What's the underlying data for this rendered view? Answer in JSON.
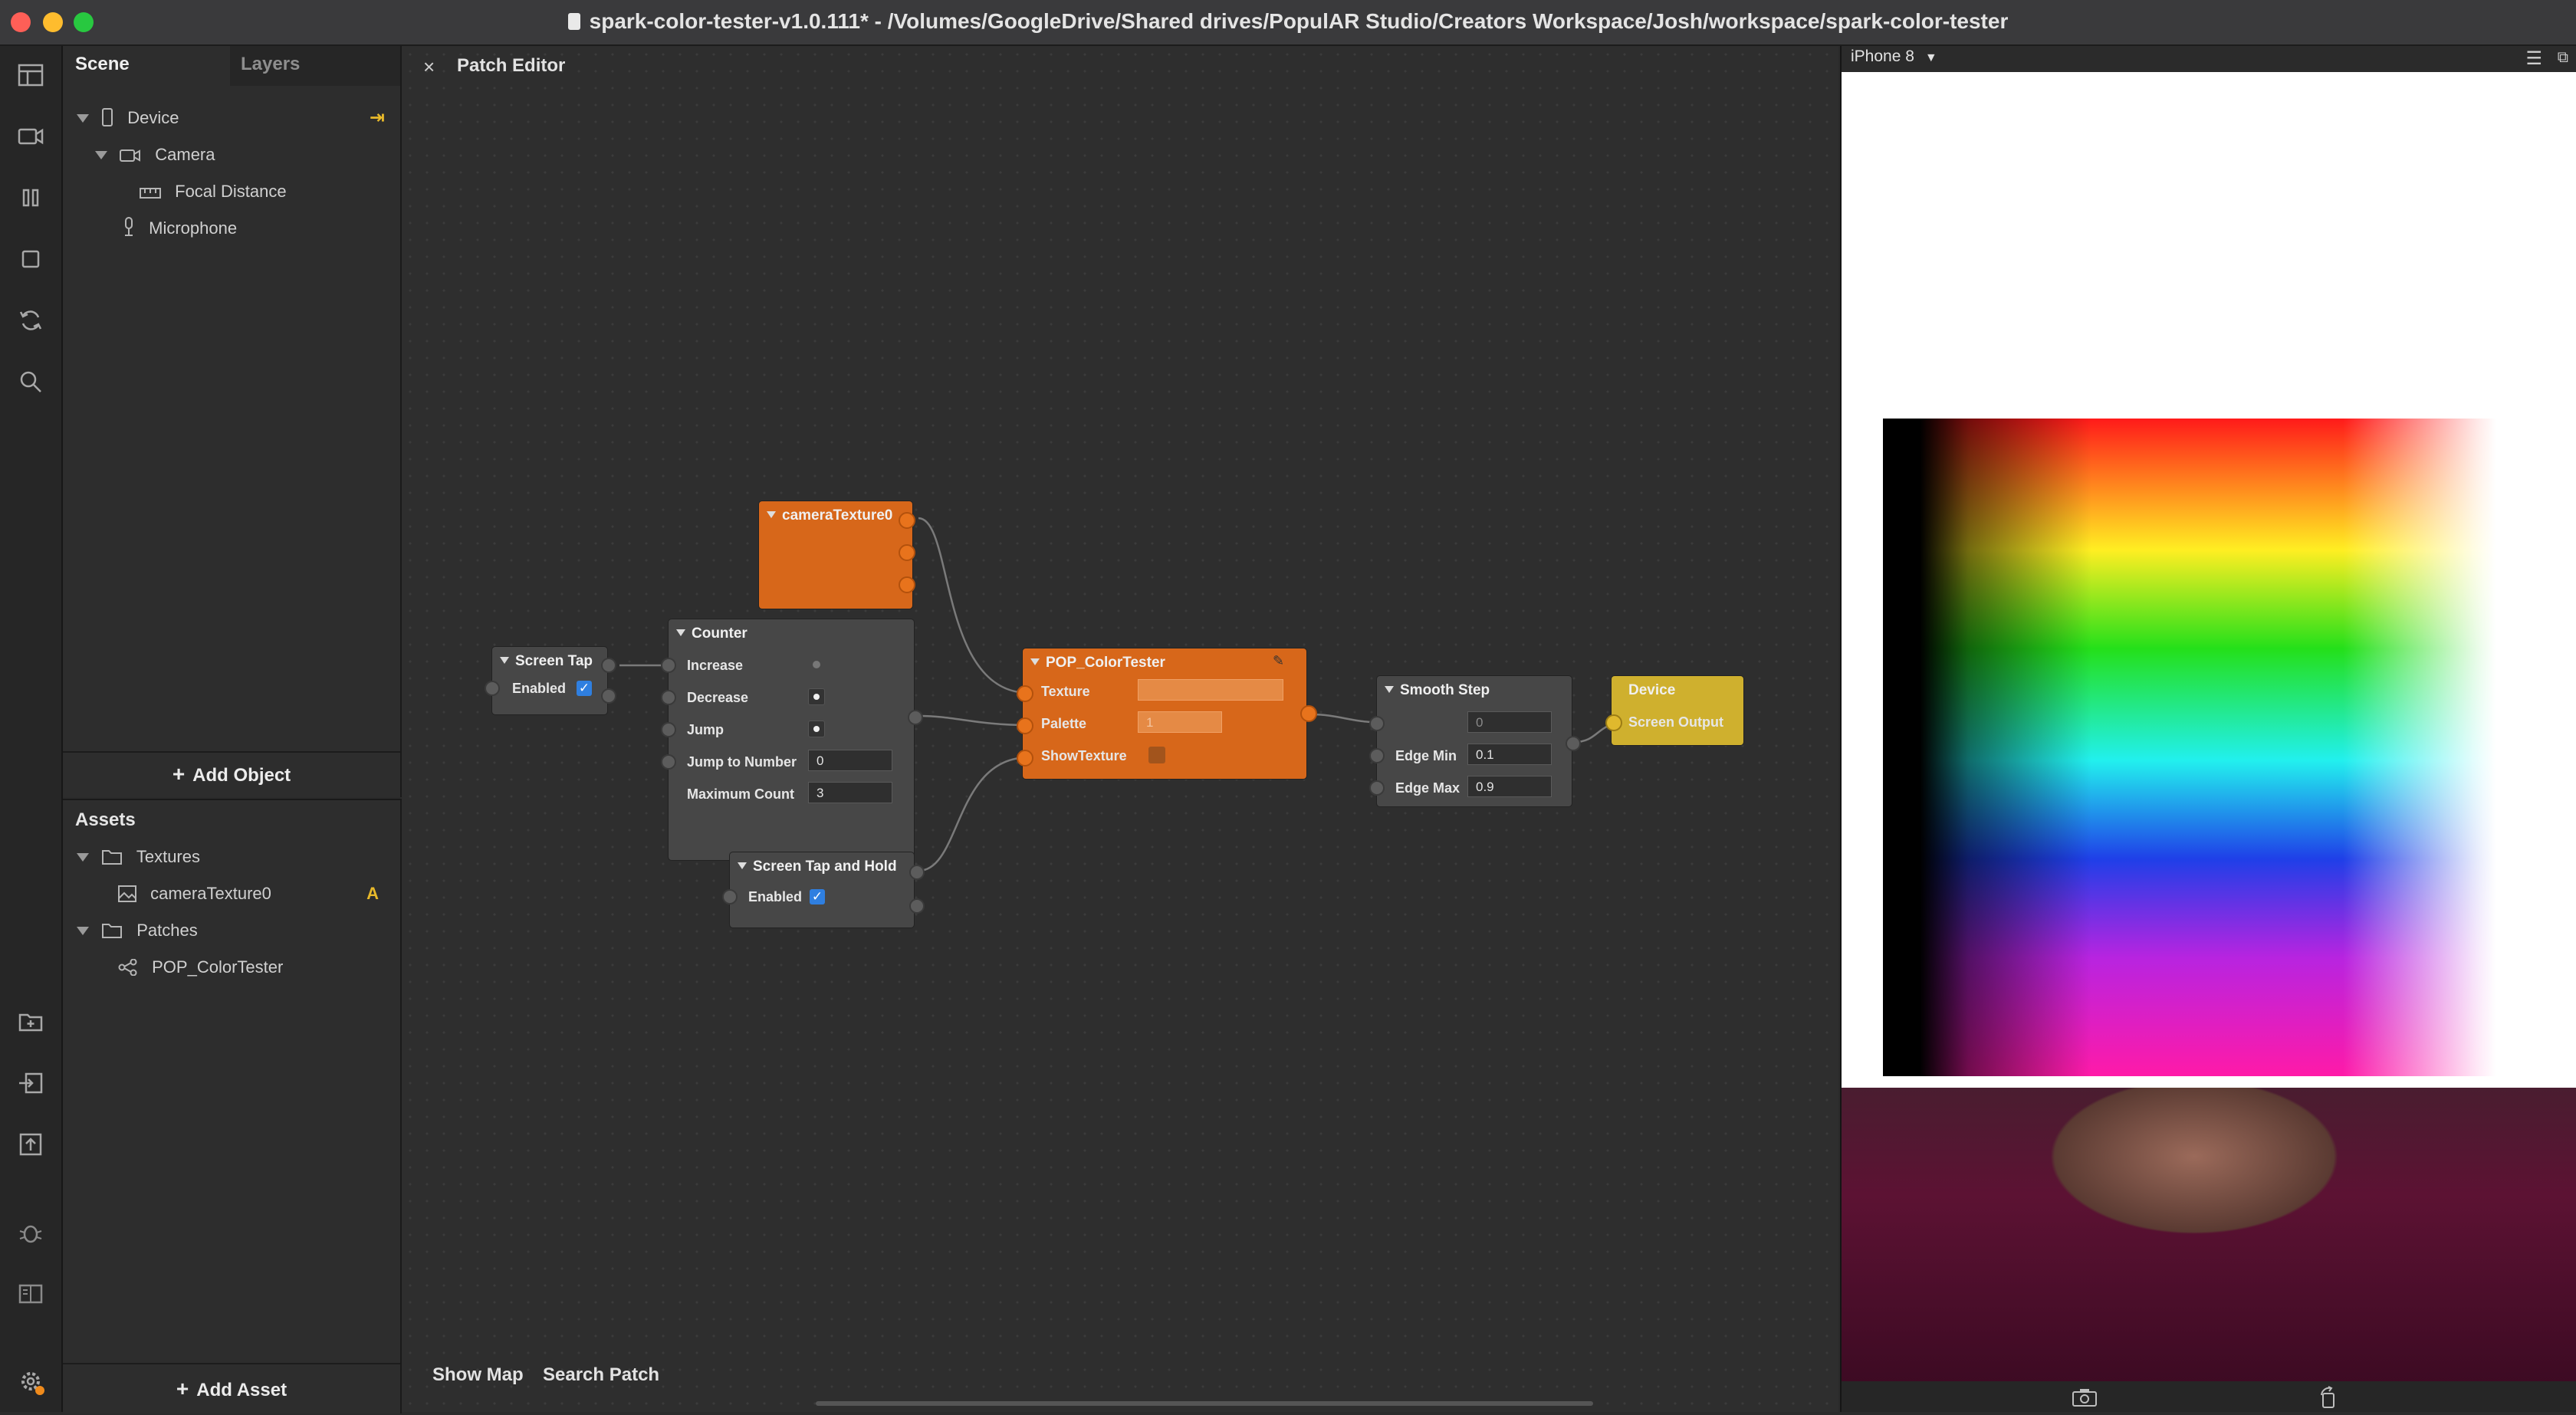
{
  "window": {
    "title": "spark-color-tester-v1.0.111* - /Volumes/GoogleDrive/Shared drives/PopulAR Studio/Creators Workspace/Josh/workspace/spark-color-tester"
  },
  "scene_panel": {
    "tabs": [
      "Scene",
      "Layers"
    ],
    "tree": {
      "device": "Device",
      "camera": "Camera",
      "focal_distance": "Focal Distance",
      "microphone": "Microphone"
    },
    "add_object": "Add Object"
  },
  "assets_panel": {
    "title": "Assets",
    "textures_folder": "Textures",
    "texture_item": "cameraTexture0",
    "texture_badge": "A",
    "patches_folder": "Patches",
    "patch_item": "POP_ColorTester",
    "add_asset": "Add Asset"
  },
  "patch_editor": {
    "title": "Patch Editor",
    "show_map": "Show Map",
    "search_patch": "Search Patch",
    "nodes": {
      "camera_texture": {
        "title": "cameraTexture0"
      },
      "screen_tap": {
        "title": "Screen Tap",
        "enabled": "Enabled"
      },
      "counter": {
        "title": "Counter",
        "increase": "Increase",
        "decrease": "Decrease",
        "jump": "Jump",
        "jump_to_number": "Jump to Number",
        "jump_to_number_value": "0",
        "maximum_count": "Maximum Count",
        "maximum_count_value": "3"
      },
      "color_tester": {
        "title": "POP_ColorTester",
        "texture": "Texture",
        "palette": "Palette",
        "palette_value": "1",
        "show_texture": "ShowTexture"
      },
      "screen_tap_hold": {
        "title": "Screen Tap and Hold",
        "enabled": "Enabled"
      },
      "smooth_step": {
        "title": "Smooth Step",
        "input_value": "0",
        "edge_min": "Edge Min",
        "edge_min_value": "0.1",
        "edge_max": "Edge Max",
        "edge_max_value": "0.9"
      },
      "device_output": {
        "title": "Device",
        "screen_output": "Screen Output"
      }
    }
  },
  "preview": {
    "device": "iPhone 8"
  },
  "colors": {
    "patch_orange": "#d7671a",
    "device_yellow": "#cfb02e",
    "node_gray": "#474747",
    "accent_blue": "#2f7fe0"
  }
}
